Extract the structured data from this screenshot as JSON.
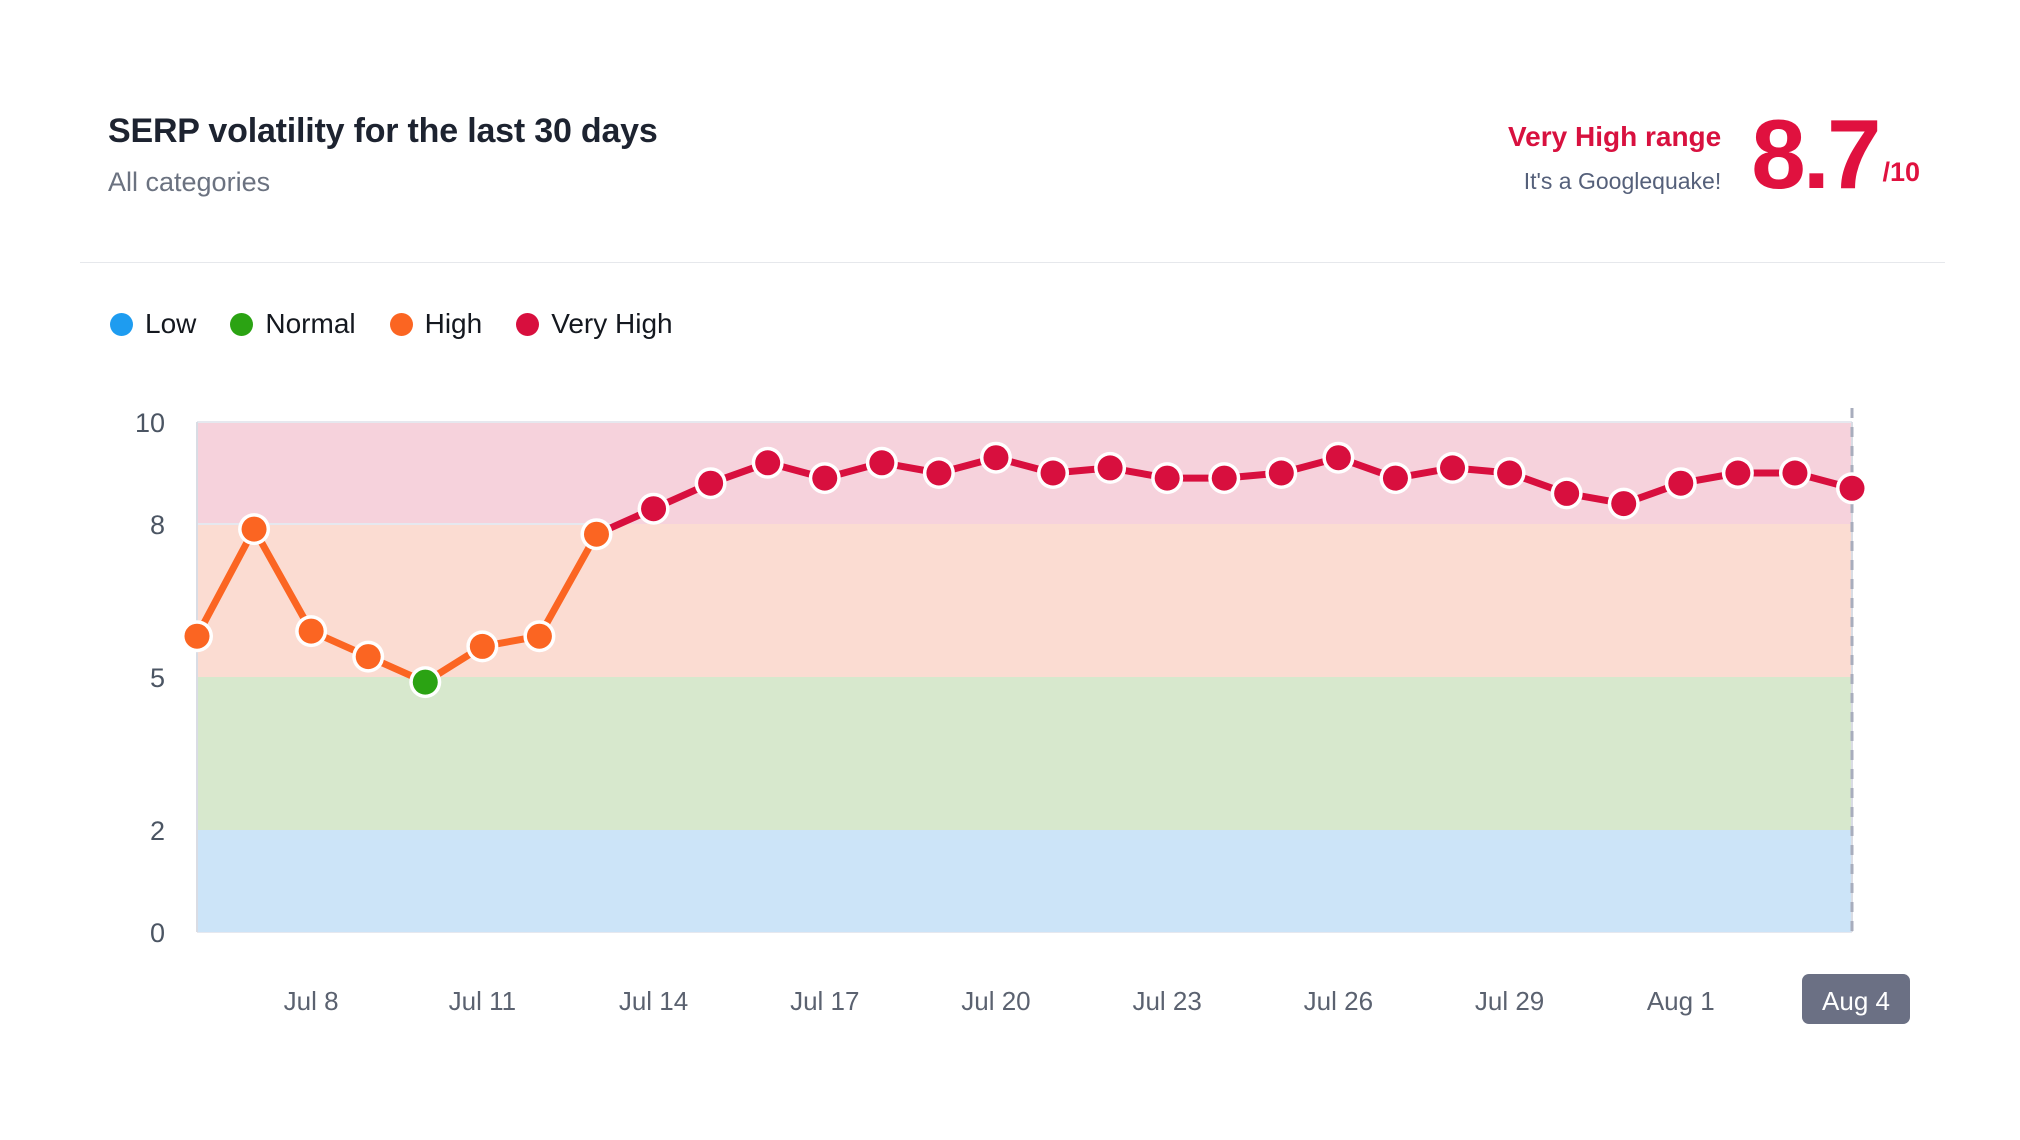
{
  "header": {
    "title": "SERP volatility for the last 30 days",
    "subtitle": "All categories",
    "score_range_label": "Very High range",
    "score_note": "It's a Googlequake!",
    "score_value": "8.7",
    "score_denominator": "/10"
  },
  "colors": {
    "low": "#1e9cf0",
    "normal": "#2ba313",
    "high": "#fb6522",
    "very_high": "#d80f3e",
    "band_low_fill": "#cce4f8",
    "band_normal_fill": "#d7e8cd",
    "band_high_fill": "#fbdcd2",
    "band_very_high_fill": "#f6d2dc",
    "grid": "#e6e8ef",
    "axis_text": "#4b5563",
    "active_tick_bg": "#6b7084",
    "title_text": "#1d2330",
    "subtitle_text": "#6b7280"
  },
  "legend": {
    "items": [
      {
        "label": "Low",
        "color": "#1e9cf0"
      },
      {
        "label": "Normal",
        "color": "#2ba313"
      },
      {
        "label": "High",
        "color": "#fb6522"
      },
      {
        "label": "Very High",
        "color": "#d80f3e"
      }
    ]
  },
  "chart_data": {
    "type": "line",
    "title": "SERP volatility for the last 30 days",
    "subtitle": "All categories",
    "xlabel": "",
    "ylabel": "",
    "ylim": [
      0,
      10
    ],
    "yticks": [
      0,
      2,
      5,
      8,
      10
    ],
    "grid": true,
    "legend_position": "top-left",
    "xtick_labels": [
      "Jul 8",
      "Jul 11",
      "Jul 14",
      "Jul 17",
      "Jul 20",
      "Jul 23",
      "Jul 26",
      "Jul 29",
      "Aug 1",
      "Aug 4"
    ],
    "xtick_active": "Aug 4",
    "bands": [
      {
        "name": "Low",
        "from": 0,
        "to": 2,
        "fill": "#cce4f8"
      },
      {
        "name": "Normal",
        "from": 2,
        "to": 5,
        "fill": "#d7e8cd"
      },
      {
        "name": "High",
        "from": 5,
        "to": 8,
        "fill": "#fbdcd2"
      },
      {
        "name": "Very High",
        "from": 8,
        "to": 10,
        "fill": "#f6d2dc"
      }
    ],
    "x": [
      "Jul 6",
      "Jul 7",
      "Jul 8",
      "Jul 9",
      "Jul 10",
      "Jul 11",
      "Jul 12",
      "Jul 13",
      "Jul 14",
      "Jul 15",
      "Jul 16",
      "Jul 17",
      "Jul 18",
      "Jul 19",
      "Jul 20",
      "Jul 21",
      "Jul 22",
      "Jul 23",
      "Jul 24",
      "Jul 25",
      "Jul 26",
      "Jul 27",
      "Jul 28",
      "Jul 29",
      "Jul 30",
      "Jul 31",
      "Aug 1",
      "Aug 2",
      "Aug 3",
      "Aug 4"
    ],
    "values": [
      5.8,
      7.9,
      5.9,
      5.4,
      4.9,
      5.6,
      5.8,
      7.8,
      8.3,
      8.8,
      9.2,
      8.9,
      9.2,
      9.0,
      9.3,
      9.0,
      9.1,
      8.9,
      8.9,
      9.0,
      9.3,
      8.9,
      9.1,
      9.0,
      8.6,
      8.4,
      8.8,
      9.0,
      9.0,
      8.7
    ],
    "point_levels": [
      "High",
      "High",
      "High",
      "High",
      "Normal",
      "High",
      "High",
      "High",
      "Very High",
      "Very High",
      "Very High",
      "Very High",
      "Very High",
      "Very High",
      "Very High",
      "Very High",
      "Very High",
      "Very High",
      "Very High",
      "Very High",
      "Very High",
      "Very High",
      "Very High",
      "Very High",
      "Very High",
      "Very High",
      "Very High",
      "Very High",
      "Very High",
      "Very High"
    ],
    "current_marker": {
      "label": "Aug 4",
      "value": 8.7,
      "dashed": true
    }
  }
}
